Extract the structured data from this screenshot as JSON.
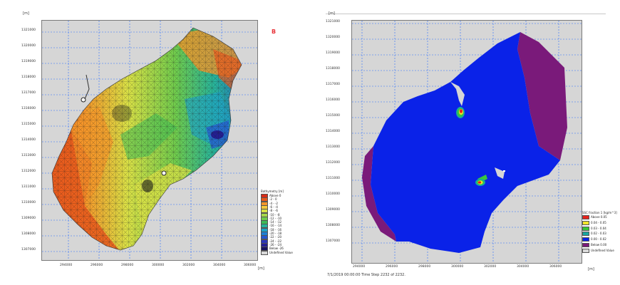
{
  "left": {
    "unit_y": "[m]",
    "unit_x": "[m]",
    "tag": "B",
    "y_ticks": [
      "1321000",
      "1320000",
      "1319000",
      "1318000",
      "1317000",
      "1316000",
      "1315000",
      "1314000",
      "1313000",
      "1312000",
      "1311000",
      "1310000",
      "1309000",
      "1308000",
      "1307000"
    ],
    "x_ticks": [
      "294000",
      "296000",
      "298000",
      "300000",
      "302000",
      "304000",
      "306000"
    ],
    "legend": {
      "title": "Bathymetry [m]",
      "items": [
        {
          "label": "Above 0",
          "color": "#d62b17"
        },
        {
          "label": "-2 - 0",
          "color": "#e8581c"
        },
        {
          "label": "-4 - -2",
          "color": "#f3962a"
        },
        {
          "label": "-6 - -4",
          "color": "#f7c93a"
        },
        {
          "label": "-8 - -6",
          "color": "#d8e046"
        },
        {
          "label": "-10 - -8",
          "color": "#a6d84a"
        },
        {
          "label": "-12 - -10",
          "color": "#6fcb4c"
        },
        {
          "label": "-14 - -12",
          "color": "#3dbb55"
        },
        {
          "label": "-16 - -14",
          "color": "#27b39a"
        },
        {
          "label": "-18 - -16",
          "color": "#1fa3c7"
        },
        {
          "label": "-20 - -18",
          "color": "#1e7fd3"
        },
        {
          "label": "-22 - -20",
          "color": "#2558cf"
        },
        {
          "label": "-24 - -22",
          "color": "#2a35b8"
        },
        {
          "label": "-26 - -24",
          "color": "#241f91"
        },
        {
          "label": "Below -26",
          "color": "#17125e"
        },
        {
          "label": "Undefined Value",
          "color": "#d9d9d9"
        }
      ]
    }
  },
  "right": {
    "unit_y": "[m]",
    "unit_x": "[m]",
    "y_ticks": [
      "1321000",
      "1320000",
      "1319000",
      "1318000",
      "1317000",
      "1316000",
      "1315000",
      "1314000",
      "1313000",
      "1312000",
      "1311000",
      "1310000",
      "1309000",
      "1308000",
      "1307000"
    ],
    "x_ticks": [
      "294000",
      "296000",
      "298000",
      "300000",
      "302000",
      "304000",
      "306000"
    ],
    "status": "7/1/2019 00:00:00 Time Step 2232 of 2232.",
    "legend": {
      "title": "SSC fraction 1 [kg/m^3]",
      "items": [
        {
          "label": "Above 0.05",
          "color": "#e8231c"
        },
        {
          "label": "0.04 - 0.05",
          "color": "#f2e52c"
        },
        {
          "label": "0.03 - 0.04",
          "color": "#39c63c"
        },
        {
          "label": "0.02 - 0.03",
          "color": "#18a7a0"
        },
        {
          "label": "0.00 - 0.02",
          "color": "#0a22e8"
        },
        {
          "label": "Below 0.00",
          "color": "#7a1a7a"
        },
        {
          "label": "Undefined Value",
          "color": "#d9d9d9"
        }
      ]
    }
  },
  "colors": {
    "plot_bg": "#d6d6d6",
    "grid": "#2b6cff",
    "ssc_blue": "#0a22e8",
    "ssc_purple": "#7a1a7a",
    "tag": "#e8343a"
  }
}
